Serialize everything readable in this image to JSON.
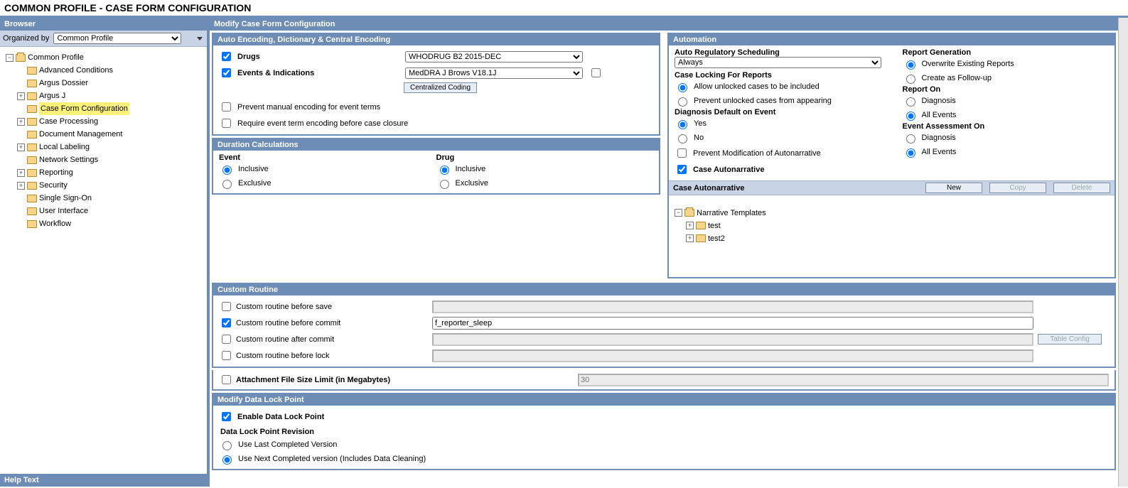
{
  "pageTitle": "COMMON PROFILE - CASE FORM CONFIGURATION",
  "browser": {
    "header": "Browser",
    "organizedByLabel": "Organized by",
    "organizedByValue": "Common Profile",
    "tree": {
      "root": "Common Profile",
      "items": [
        {
          "label": "Advanced Conditions",
          "exp": ""
        },
        {
          "label": "Argus Dossier",
          "exp": ""
        },
        {
          "label": "Argus J",
          "exp": "+"
        },
        {
          "label": "Case Form Configuration",
          "exp": "",
          "sel": true
        },
        {
          "label": "Case Processing",
          "exp": "+"
        },
        {
          "label": "Document Management",
          "exp": ""
        },
        {
          "label": "Local Labeling",
          "exp": "+"
        },
        {
          "label": "Network Settings",
          "exp": ""
        },
        {
          "label": "Reporting",
          "exp": "+"
        },
        {
          "label": "Security",
          "exp": "+"
        },
        {
          "label": "Single Sign-On",
          "exp": ""
        },
        {
          "label": "User Interface",
          "exp": ""
        },
        {
          "label": "Workflow",
          "exp": ""
        }
      ]
    }
  },
  "main": {
    "header": "Modify Case Form Configuration",
    "encoding": {
      "header": "Auto Encoding, Dictionary & Central Encoding",
      "drugsLabel": "Drugs",
      "drugsValue": "WHODRUG B2 2015-DEC",
      "eventsLabel": "Events & Indications",
      "eventsValue": "MedDRA J Brows V18.1J",
      "centralBtn": "Centralized Coding",
      "preventManual": "Prevent manual encoding for event terms",
      "requireEncoding": "Require event term encoding before case closure"
    },
    "duration": {
      "header": "Duration Calculations",
      "eventLabel": "Event",
      "drugLabel": "Drug",
      "inclusive": "Inclusive",
      "exclusive": "Exclusive"
    },
    "automation": {
      "header": "Automation",
      "autoRegLabel": "Auto Regulatory Scheduling",
      "autoRegValue": "Always",
      "caseLockLabel": "Case Locking For Reports",
      "allowUnlocked": "Allow unlocked cases to be included",
      "preventUnlocked": "Prevent unlocked cases from appearing",
      "diagDefaultLabel": "Diagnosis Default on Event",
      "yes": "Yes",
      "no": "No",
      "preventMod": "Prevent Modification of Autonarrative",
      "caseAutonarr": "Case Autonarrative",
      "reportGenLabel": "Report Generation",
      "overwrite": "Overwrite Existing Reports",
      "followup": "Create as Follow-up",
      "reportOnLabel": "Report On",
      "diagnosis": "Diagnosis",
      "allEvents": "All Events",
      "eventAssessLabel": "Event Assessment On",
      "narr": {
        "header": "Case Autonarrative",
        "new": "New",
        "copy": "Copy",
        "delete": "Delete",
        "root": "Narrative Templates",
        "items": [
          "test",
          "test2"
        ]
      }
    },
    "custom": {
      "header": "Custom Routine",
      "beforeSave": "Custom routine before save",
      "beforeCommit": "Custom routine before commit",
      "beforeCommitVal": "f_reporter_sleep",
      "afterCommit": "Custom routine after commit",
      "beforeLock": "Custom routine before lock",
      "tableConfig": "Table Config"
    },
    "attach": {
      "label": "Attachment File Size Limit (in Megabytes)",
      "value": "30"
    },
    "dlp": {
      "header": "Modify Data Lock Point",
      "enable": "Enable Data Lock Point",
      "revisionLabel": "Data Lock Point Revision",
      "useLast": "Use Last Completed Version",
      "useNext": "Use Next Completed version (Includes Data Cleaning)"
    }
  },
  "helpText": "Help Text"
}
